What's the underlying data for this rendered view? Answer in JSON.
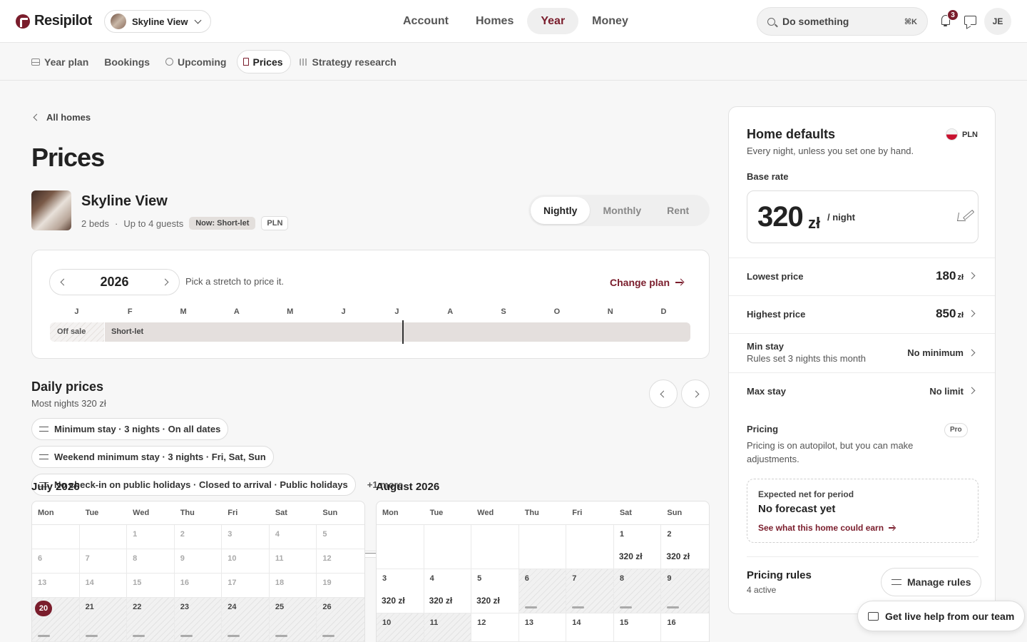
{
  "brand": {
    "name": "Resipilot",
    "accent": "#7a1d2c"
  },
  "home_switcher": {
    "label": "Skyline View"
  },
  "main_nav": [
    {
      "label": "Account",
      "active": false
    },
    {
      "label": "Homes",
      "active": false
    },
    {
      "label": "Year",
      "active": true
    },
    {
      "label": "Money",
      "active": false
    }
  ],
  "search": {
    "placeholder": "Do something",
    "shortcut": "⌘K"
  },
  "notifications": {
    "count": "3"
  },
  "user": {
    "initials": "JE"
  },
  "sub_nav": [
    {
      "label": "Year plan",
      "icon": "year-plan-icon",
      "active": false
    },
    {
      "label": "Bookings",
      "icon": "calendar-icon",
      "active": false
    },
    {
      "label": "Upcoming",
      "icon": "clock-icon",
      "active": false
    },
    {
      "label": "Prices",
      "icon": "bookmark-icon",
      "active": true
    },
    {
      "label": "Strategy research",
      "icon": "bar-chart-icon",
      "active": false
    }
  ],
  "back_link": "All homes",
  "page_title": "Prices",
  "home": {
    "name": "Skyline View",
    "beds": "2 beds",
    "separator": "·",
    "guests": "Up to 4 guests",
    "status": "Now: Short-let",
    "currency": "PLN"
  },
  "rate_modes": [
    {
      "label": "Nightly",
      "active": true
    },
    {
      "label": "Monthly",
      "active": false
    },
    {
      "label": "Rent",
      "active": false
    }
  ],
  "year_plan": {
    "year": "2026",
    "hint": "Pick a stretch to price it.",
    "change_plan": "Change plan",
    "months": [
      "J",
      "F",
      "M",
      "A",
      "M",
      "J",
      "J",
      "A",
      "S",
      "O",
      "N",
      "D"
    ],
    "segments": {
      "off_sale": "Off sale",
      "short_let": "Short-let"
    }
  },
  "daily": {
    "title": "Daily prices",
    "subtitle": "Most nights 320 zł",
    "rules": [
      "Minimum stay · 3 nights · On all dates",
      "Weekend minimum stay · 3 nights · Fri, Sat, Sun",
      "No check-in on public holidays · Closed to arrival · Public holidays"
    ],
    "more": "+1 more"
  },
  "weekdays": [
    "Mon",
    "Tue",
    "Wed",
    "Thu",
    "Fri",
    "Sat",
    "Sun"
  ],
  "calendars": [
    {
      "title": "July 2026",
      "rows": [
        [
          {
            "d": "",
            "t": "past"
          },
          {
            "d": "",
            "t": "past"
          },
          {
            "d": "1",
            "t": "past"
          },
          {
            "d": "2",
            "t": "past"
          },
          {
            "d": "3",
            "t": "past"
          },
          {
            "d": "4",
            "t": "past"
          },
          {
            "d": "5",
            "t": "past"
          }
        ],
        [
          {
            "d": "6",
            "t": "past"
          },
          {
            "d": "7",
            "t": "past"
          },
          {
            "d": "8",
            "t": "past"
          },
          {
            "d": "9",
            "t": "past"
          },
          {
            "d": "10",
            "t": "past"
          },
          {
            "d": "11",
            "t": "past"
          },
          {
            "d": "12",
            "t": "past"
          }
        ],
        [
          {
            "d": "13",
            "t": "past"
          },
          {
            "d": "14",
            "t": "past"
          },
          {
            "d": "15",
            "t": "past"
          },
          {
            "d": "16",
            "t": "past"
          },
          {
            "d": "17",
            "t": "past"
          },
          {
            "d": "18",
            "t": "past"
          },
          {
            "d": "19",
            "t": "past"
          }
        ],
        [
          {
            "d": "20",
            "t": "today"
          },
          {
            "d": "21",
            "t": "blocked"
          },
          {
            "d": "22",
            "t": "blocked"
          },
          {
            "d": "23",
            "t": "blocked"
          },
          {
            "d": "24",
            "t": "blocked"
          },
          {
            "d": "25",
            "t": "blocked"
          },
          {
            "d": "26",
            "t": "blocked"
          }
        ]
      ]
    },
    {
      "title": "August 2026",
      "rows": [
        [
          {
            "d": "",
            "t": "empty"
          },
          {
            "d": "",
            "t": "empty"
          },
          {
            "d": "",
            "t": "empty"
          },
          {
            "d": "",
            "t": "empty"
          },
          {
            "d": "",
            "t": "empty"
          },
          {
            "d": "1",
            "t": "price",
            "p": "320 zł"
          },
          {
            "d": "2",
            "t": "price",
            "p": "320 zł"
          }
        ],
        [
          {
            "d": "3",
            "t": "price",
            "p": "320 zł"
          },
          {
            "d": "4",
            "t": "price",
            "p": "320 zł"
          },
          {
            "d": "5",
            "t": "price",
            "p": "320 zł"
          },
          {
            "d": "6",
            "t": "blocked"
          },
          {
            "d": "7",
            "t": "blocked"
          },
          {
            "d": "8",
            "t": "blocked"
          },
          {
            "d": "9",
            "t": "blocked"
          }
        ],
        [
          {
            "d": "10",
            "t": "hatched"
          },
          {
            "d": "11",
            "t": "hatched"
          },
          {
            "d": "12",
            "t": "open"
          },
          {
            "d": "13",
            "t": "open"
          },
          {
            "d": "14",
            "t": "open"
          },
          {
            "d": "15",
            "t": "open"
          },
          {
            "d": "16",
            "t": "open"
          }
        ]
      ]
    }
  ],
  "panel": {
    "title": "Home defaults",
    "subtitle": "Every night, unless you set one by hand.",
    "currency": "PLN",
    "base_rate_label": "Base rate",
    "base_rate": "320",
    "base_unit": "zł",
    "base_per": "/ night",
    "rows": [
      {
        "label": "Lowest price",
        "value": "180",
        "unit": "zł",
        "big": true
      },
      {
        "label": "Highest price",
        "value": "850",
        "unit": "zł",
        "big": true
      },
      {
        "label": "Min stay",
        "sub": "Rules set 3 nights this month",
        "value": "No minimum"
      },
      {
        "label": "Max stay",
        "value": "No limit"
      }
    ],
    "pricing_label": "Pricing",
    "pro": "Pro",
    "pricing_text": "Pricing is on autopilot, but you can make adjustments.",
    "forecast_label": "Expected net for period",
    "forecast_value": "No forecast yet",
    "forecast_link": "See what this home could earn",
    "rules_title": "Pricing rules",
    "rules_count": "4 active",
    "manage_rules": "Manage rules"
  },
  "help": "Get live help from our team"
}
